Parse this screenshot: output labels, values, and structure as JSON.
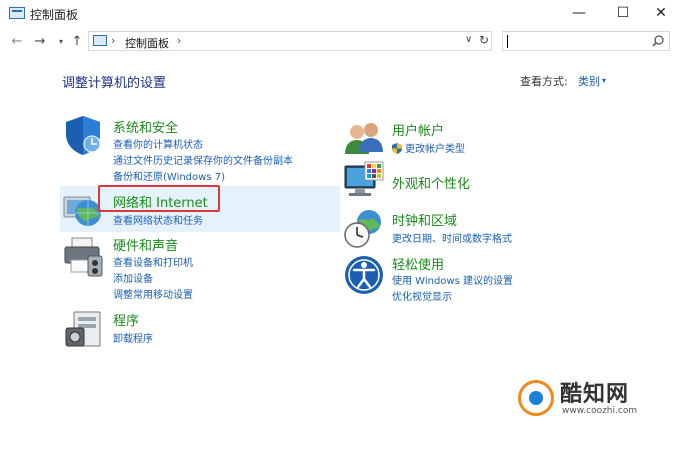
{
  "window": {
    "title": "控制面板",
    "min_glyph": "—",
    "max_glyph": "☐",
    "close_glyph": "✕"
  },
  "nav": {
    "back": "←",
    "forward": "→",
    "recent": "▾",
    "up": "↑",
    "address_sep": "›",
    "breadcrumb": "控制面板",
    "address_dropdown": "∨",
    "refresh": "↻",
    "search_placeholder": ""
  },
  "content": {
    "heading": "调整计算机的设置",
    "view_by_label": "查看方式:",
    "view_by_value": "类别",
    "view_by_arrow": "▾"
  },
  "categories_left": [
    {
      "title": "系统和安全",
      "icon": "shield-icon",
      "links": [
        "查看你的计算机状态",
        "通过文件历史记录保存你的文件备份副本",
        "备份和还原(Windows 7)"
      ]
    },
    {
      "title": "网络和 Internet",
      "icon": "network-globe-icon",
      "links": [
        "查看网络状态和任务"
      ]
    },
    {
      "title": "硬件和声音",
      "icon": "printer-icon",
      "links": [
        "查看设备和打印机",
        "添加设备",
        "调整常用移动设置"
      ]
    },
    {
      "title": "程序",
      "icon": "programs-icon",
      "links": [
        "卸载程序"
      ]
    }
  ],
  "categories_right": [
    {
      "title": "用户帐户",
      "icon": "users-icon",
      "links": [
        "更改帐户类型"
      ]
    },
    {
      "title": "外观和个性化",
      "icon": "monitor-palette-icon",
      "links": []
    },
    {
      "title": "时钟和区域",
      "icon": "clock-globe-icon",
      "links": [
        "更改日期、时间或数字格式"
      ]
    },
    {
      "title": "轻松使用",
      "icon": "ease-of-access-icon",
      "links": [
        "使用 Windows 建议的设置",
        "优化视觉显示"
      ]
    }
  ],
  "watermark": {
    "name": "酷知网",
    "url": "www.coozhi.com"
  },
  "colors": {
    "category_title": "#1a8a1a",
    "link": "#1a5fb4",
    "heading": "#1e3287",
    "highlight_box": "#d9393a",
    "hover_bg": "#e5f1fb"
  }
}
